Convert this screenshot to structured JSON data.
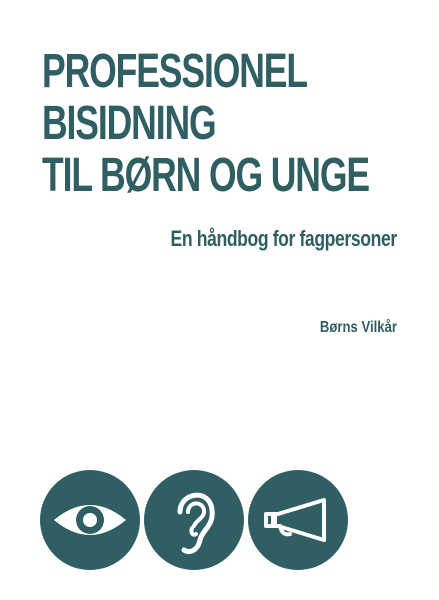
{
  "cover": {
    "title_lines": [
      "PROFESSIONEL",
      "BISIDNING",
      "TIL BØRN OG UNGE"
    ],
    "subtitle": "En håndbog for fagpersoner",
    "publisher": "Børns Vilkår"
  },
  "icons": [
    {
      "name": "eye-icon"
    },
    {
      "name": "ear-icon"
    },
    {
      "name": "megaphone-icon"
    }
  ],
  "colors": {
    "accent": "#2f5f63",
    "background": "#ffffff"
  }
}
